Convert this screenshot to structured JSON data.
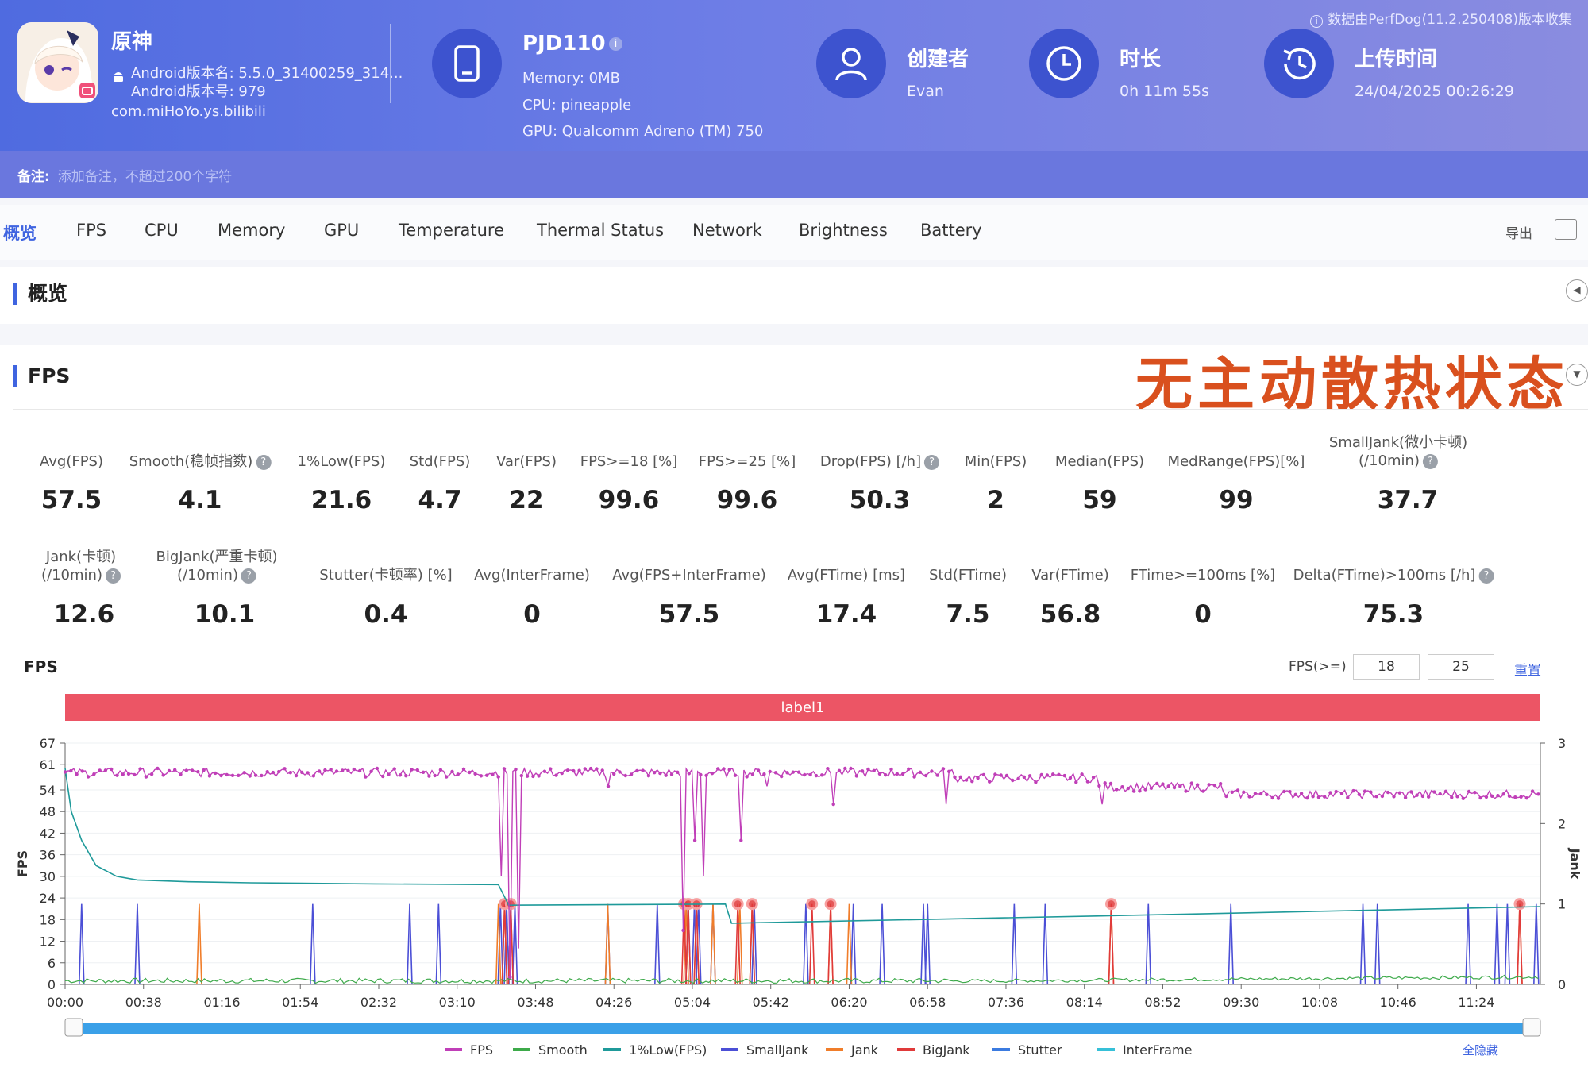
{
  "header": {
    "notice": "数据由PerfDog(11.2.250408)版本收集",
    "app_name": "原神",
    "android_version_name": "Android版本名: 5.5.0_31400259_314...",
    "android_version_code": "Android版本号: 979",
    "package": "com.miHoYo.ys.bilibili",
    "device": "PJD110",
    "memory": "Memory: 0MB",
    "cpu": "CPU: pineapple",
    "gpu": "GPU: Qualcomm Adreno (TM) 750",
    "creator_label": "创建者",
    "creator": "Evan",
    "duration_label": "时长",
    "duration": "0h 11m 55s",
    "upload_label": "上传时间",
    "upload_time": "24/04/2025 00:26:29"
  },
  "remark": {
    "label": "备注:",
    "placeholder": "添加备注，不超过200个字符"
  },
  "tabs": [
    "概览",
    "FPS",
    "CPU",
    "Memory",
    "GPU",
    "Temperature",
    "Thermal Status",
    "Network",
    "Brightness",
    "Battery"
  ],
  "export_label": "导出",
  "overview_title": "概览",
  "fps_section_title": "FPS",
  "overlay_text": "无主动散热状态",
  "metrics_row1": [
    {
      "label": "Avg(FPS)",
      "value": "57.5"
    },
    {
      "label": "Smooth(稳帧指数)",
      "value": "4.1"
    },
    {
      "label": "1%Low(FPS)",
      "value": "21.6"
    },
    {
      "label": "Std(FPS)",
      "value": "4.7"
    },
    {
      "label": "Var(FPS)",
      "value": "22"
    },
    {
      "label": "FPS>=18 [%]",
      "value": "99.6"
    },
    {
      "label": "FPS>=25 [%]",
      "value": "99.6"
    },
    {
      "label": "Drop(FPS) [/h]",
      "value": "50.3"
    },
    {
      "label": "Min(FPS)",
      "value": "2"
    },
    {
      "label": "Median(FPS)",
      "value": "59"
    },
    {
      "label": "MedRange(FPS)[%]",
      "value": "99"
    },
    {
      "label": "SmallJank(微小卡顿)",
      "label2": "(/10min)",
      "value": "37.7"
    }
  ],
  "metrics_row2": [
    {
      "label": "Jank(卡顿)",
      "label2": "(/10min)",
      "value": "12.6"
    },
    {
      "label": "BigJank(严重卡顿)",
      "label2": "(/10min)",
      "value": "10.1"
    },
    {
      "label": "Stutter(卡顿率) [%]",
      "value": "0.4"
    },
    {
      "label": "Avg(InterFrame)",
      "value": "0"
    },
    {
      "label": "Avg(FPS+InterFrame)",
      "value": "57.5"
    },
    {
      "label": "Avg(FTime) [ms]",
      "value": "17.4"
    },
    {
      "label": "Std(FTime)",
      "value": "7.5"
    },
    {
      "label": "Var(FTime)",
      "value": "56.8"
    },
    {
      "label": "FTime>=100ms [%]",
      "value": "0"
    },
    {
      "label": "Delta(FTime)>100ms [/h]",
      "value": "75.3"
    }
  ],
  "chart_controls": {
    "title": "FPS",
    "threshold_label": "FPS(>=)",
    "threshold1": "18",
    "threshold2": "25",
    "reset": "重置",
    "hide_all": "全隐藏"
  },
  "chart_data": {
    "type": "line",
    "band_label": "label1",
    "x_ticks": [
      "00:00",
      "00:38",
      "01:16",
      "01:54",
      "02:32",
      "03:10",
      "03:48",
      "04:26",
      "05:04",
      "05:42",
      "06:20",
      "06:58",
      "07:36",
      "08:14",
      "08:52",
      "09:30",
      "10:08",
      "10:46",
      "11:24"
    ],
    "x_range_seconds": [
      0,
      715
    ],
    "y_left_label": "FPS",
    "y_left_ticks": [
      0,
      6,
      12,
      18,
      24,
      30,
      36,
      42,
      48,
      54,
      61,
      67
    ],
    "y_left_range": [
      0,
      67
    ],
    "y_right_label": "Jank",
    "y_right_ticks": [
      0,
      1,
      2,
      3
    ],
    "y_right_range": [
      0,
      3
    ],
    "legend": [
      "FPS",
      "Smooth",
      "1%Low(FPS)",
      "SmallJank",
      "Jank",
      "BigJank",
      "Stutter",
      "InterFrame"
    ],
    "colors": {
      "FPS": "#c03fb8",
      "Smooth": "#3daa4a",
      "1%Low(FPS)": "#1f9a9a",
      "SmallJank": "#4b4fd6",
      "Jank": "#f07d2a",
      "BigJank": "#e03a3a",
      "Stutter": "#3b7be0",
      "InterFrame": "#36c0d8"
    },
    "fps_segments": [
      {
        "x0": 0,
        "x1": 210,
        "level": 59
      },
      {
        "x0": 210,
        "x1": 430,
        "level": 59
      },
      {
        "x0": 430,
        "x1": 500,
        "level": 57.5
      },
      {
        "x0": 500,
        "x1": 560,
        "level": 55
      },
      {
        "x0": 560,
        "x1": 715,
        "level": 53
      }
    ],
    "fps_dips": [
      {
        "x": 212,
        "fps": 30
      },
      {
        "x": 216,
        "fps": 2
      },
      {
        "x": 220,
        "fps": 10
      },
      {
        "x": 263,
        "fps": 55
      },
      {
        "x": 300,
        "fps": 15
      },
      {
        "x": 305,
        "fps": 40
      },
      {
        "x": 310,
        "fps": 30
      },
      {
        "x": 328,
        "fps": 40
      },
      {
        "x": 340,
        "fps": 55
      },
      {
        "x": 373,
        "fps": 50
      },
      {
        "x": 427,
        "fps": 50
      },
      {
        "x": 503,
        "fps": 50
      }
    ],
    "low1_curve": [
      {
        "x": 0,
        "y": 60
      },
      {
        "x": 3,
        "y": 48
      },
      {
        "x": 8,
        "y": 40
      },
      {
        "x": 15,
        "y": 33
      },
      {
        "x": 25,
        "y": 30
      },
      {
        "x": 35,
        "y": 29
      },
      {
        "x": 60,
        "y": 28.5
      },
      {
        "x": 90,
        "y": 28.2
      },
      {
        "x": 150,
        "y": 27.9
      },
      {
        "x": 210,
        "y": 27.7
      },
      {
        "x": 215,
        "y": 22
      },
      {
        "x": 320,
        "y": 22.3
      },
      {
        "x": 323,
        "y": 17
      },
      {
        "x": 500,
        "y": 19
      },
      {
        "x": 715,
        "y": 21.6
      }
    ],
    "small_jank_x": [
      8,
      35,
      120,
      167,
      181,
      211,
      214,
      216,
      218,
      263,
      287,
      302,
      305,
      307,
      314,
      334,
      359,
      382,
      396,
      416,
      418,
      460,
      475,
      525,
      565,
      629,
      636,
      680,
      694,
      699,
      713
    ],
    "jank_x": [
      65,
      210,
      213,
      263,
      301,
      306,
      314,
      327,
      333,
      371,
      380,
      507,
      705
    ],
    "big_jank_x": [
      213,
      216,
      300,
      302,
      306,
      326,
      333,
      362,
      371,
      507,
      705
    ]
  }
}
